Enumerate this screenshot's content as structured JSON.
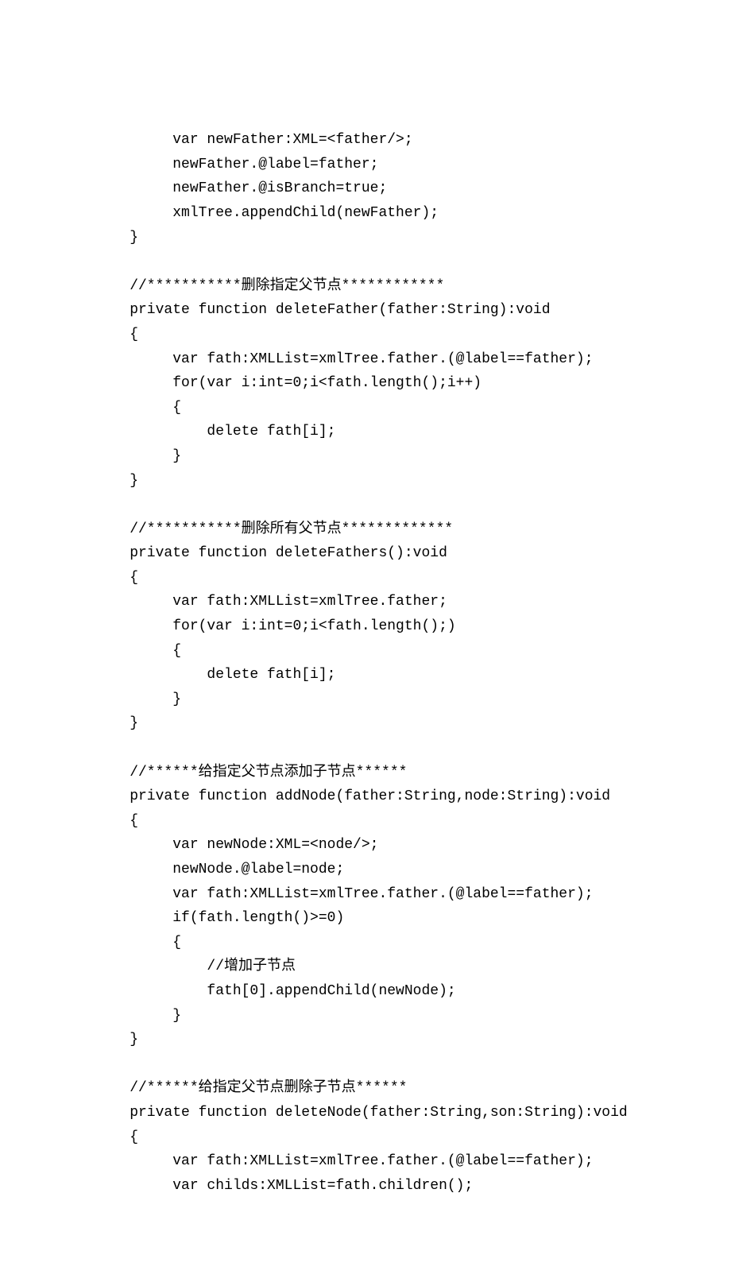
{
  "code": {
    "lines": [
      "         var newFather:XML=<father/>;",
      "         newFather.@label=father;",
      "         newFather.@isBranch=true;",
      "         xmlTree.appendChild(newFather);",
      "    }",
      "",
      "    //***********删除指定父节点************",
      "    private function deleteFather(father:String):void",
      "    {",
      "         var fath:XMLList=xmlTree.father.(@label==father);",
      "         for(var i:int=0;i<fath.length();i++)",
      "         {",
      "             delete fath[i];",
      "         }",
      "    }",
      "",
      "    //***********删除所有父节点*************",
      "    private function deleteFathers():void",
      "    {",
      "         var fath:XMLList=xmlTree.father;",
      "         for(var i:int=0;i<fath.length();)",
      "         {",
      "             delete fath[i];",
      "         }",
      "    }",
      "",
      "    //******给指定父节点添加子节点******",
      "    private function addNode(father:String,node:String):void",
      "    {",
      "         var newNode:XML=<node/>;",
      "         newNode.@label=node;",
      "         var fath:XMLList=xmlTree.father.(@label==father);",
      "         if(fath.length()>=0)",
      "         {",
      "             //增加子节点",
      "             fath[0].appendChild(newNode);",
      "         }",
      "    }",
      "",
      "    //******给指定父节点删除子节点******",
      "    private function deleteNode(father:String,son:String):void",
      "    {",
      "         var fath:XMLList=xmlTree.father.(@label==father);",
      "         var childs:XMLList=fath.children();"
    ]
  }
}
